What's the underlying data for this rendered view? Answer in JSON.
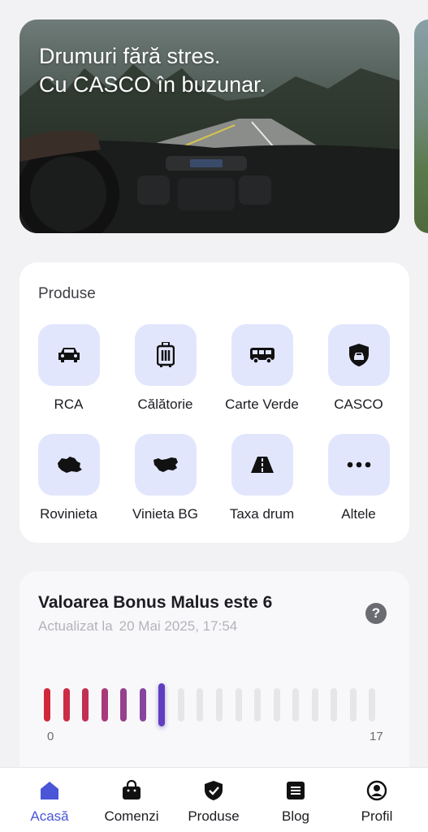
{
  "hero": {
    "title": "Drumuri fără stres.\nCu CASCO în buzunar."
  },
  "products": {
    "section_title": "Produse",
    "items": [
      {
        "label": "RCA",
        "icon": "car-icon"
      },
      {
        "label": "Călătorie",
        "icon": "luggage-icon"
      },
      {
        "label": "Carte Verde",
        "icon": "van-icon"
      },
      {
        "label": "CASCO",
        "icon": "car-shield-icon"
      },
      {
        "label": "Rovinieta",
        "icon": "romania-map-icon"
      },
      {
        "label": "Vinieta BG",
        "icon": "bulgaria-map-icon"
      },
      {
        "label": "Taxa drum",
        "icon": "road-icon"
      },
      {
        "label": "Altele",
        "icon": "more-dots-icon"
      }
    ]
  },
  "bonus_malus": {
    "title": "Valoarea Bonus Malus este 6",
    "updated_label": "Actualizat la",
    "updated_value": "20 Mai 2025, 17:54",
    "help_icon": "?",
    "scale_min": "0",
    "scale_max": "17",
    "current_value": 6,
    "tick_colors": [
      "#d0283a",
      "#cc2c45",
      "#c12f55",
      "#a93a7a",
      "#96408e",
      "#86469d",
      "#5f3fbf"
    ],
    "inactive_color": "#e6e6e8"
  },
  "nav": {
    "items": [
      {
        "label": "Acasă",
        "icon": "home-icon",
        "active": true
      },
      {
        "label": "Comenzi",
        "icon": "shopping-bag-icon",
        "active": false
      },
      {
        "label": "Produse",
        "icon": "shield-check-icon",
        "active": false
      },
      {
        "label": "Blog",
        "icon": "blog-icon",
        "active": false
      },
      {
        "label": "Profil",
        "icon": "profile-icon",
        "active": false
      }
    ],
    "active_color": "#4a55d8"
  }
}
